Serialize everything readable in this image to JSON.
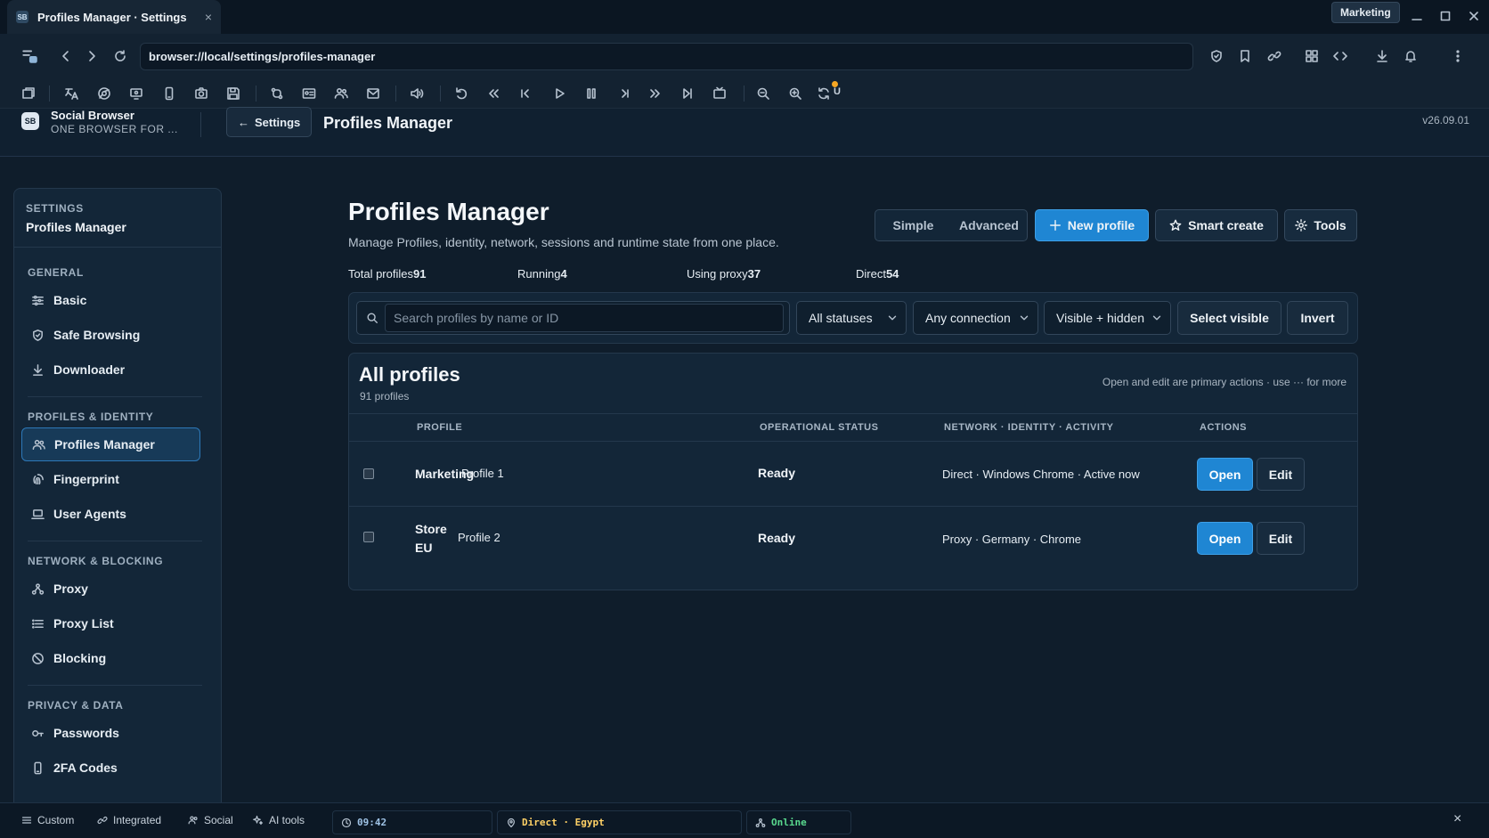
{
  "window": {
    "tab_title": "Profiles Manager · Settings",
    "tab_close": "×",
    "favicon_text": "SB",
    "active_profile": "Marketing"
  },
  "address_bar": {
    "url": "browser://local/settings/profiles-manager"
  },
  "toolbar": {
    "badge": "U"
  },
  "app_header": {
    "logo_text": "SB",
    "brand_name": "Social Browser",
    "brand_tagline": "ONE BROWSER FOR ...",
    "back_label": "Settings",
    "back_arrow": "←",
    "title": "Profiles Manager",
    "version": "v26.09.01"
  },
  "sidebar": {
    "label": "SETTINGS",
    "title": "Profiles Manager",
    "sections": [
      {
        "title": "GENERAL",
        "items": [
          {
            "label": "Basic",
            "icon": "sliders-icon"
          },
          {
            "label": "Safe Browsing",
            "icon": "shield-icon"
          },
          {
            "label": "Downloader",
            "icon": "download-icon"
          }
        ]
      },
      {
        "title": "PROFILES & IDENTITY",
        "items": [
          {
            "label": "Profiles Manager",
            "icon": "users-icon",
            "active": true
          },
          {
            "label": "Fingerprint",
            "icon": "fingerprint-icon"
          },
          {
            "label": "User Agents",
            "icon": "laptop-icon"
          }
        ]
      },
      {
        "title": "NETWORK & BLOCKING",
        "items": [
          {
            "label": "Proxy",
            "icon": "network-icon"
          },
          {
            "label": "Proxy List",
            "icon": "list-icon"
          },
          {
            "label": "Blocking",
            "icon": "ban-icon"
          }
        ]
      },
      {
        "title": "PRIVACY & DATA",
        "items": [
          {
            "label": "Passwords",
            "icon": "key-icon"
          },
          {
            "label": "2FA Codes",
            "icon": "phone-icon"
          }
        ]
      }
    ]
  },
  "main": {
    "title": "Profiles Manager",
    "subtitle": "Manage Profiles, identity, network, sessions and runtime state from one place.",
    "mode_toggle": [
      "Simple",
      "Advanced"
    ],
    "buttons": {
      "new_profile": "New profile",
      "smart_create": "Smart create",
      "tools": "Tools"
    },
    "stats": [
      {
        "label": "Total profiles",
        "value": "91"
      },
      {
        "label": "Running",
        "value": "4"
      },
      {
        "label": "Using proxy",
        "value": "37"
      },
      {
        "label": "Direct",
        "value": "54"
      }
    ],
    "filters": {
      "search_placeholder": "Search profiles by name or ID",
      "status": "All statuses",
      "connection": "Any connection",
      "visibility": "Visible + hidden",
      "select_visible": "Select visible",
      "invert": "Invert"
    },
    "table": {
      "title": "All profiles",
      "count": "91 profiles",
      "hint": "Open and edit are primary actions · use ··· for more",
      "columns": [
        "PROFILE",
        "OPERATIONAL STATUS",
        "NETWORK · IDENTITY · ACTIVITY",
        "ACTIONS"
      ],
      "rows": [
        {
          "name": "Marketing",
          "id": "Profile 1",
          "status": "Ready",
          "network": "Direct · Windows Chrome · Active now",
          "open": "Open",
          "edit": "Edit"
        },
        {
          "name_line1": "Store",
          "name_line2": "EU",
          "id": "Profile 2",
          "status": "Ready",
          "network": "Proxy · Germany · Chrome",
          "open": "Open",
          "edit": "Edit"
        }
      ]
    }
  },
  "status_bar": {
    "items": [
      "Custom",
      "Integrated",
      "Social",
      "AI tools"
    ],
    "time": "09:42",
    "connection": "Direct · Egypt",
    "online": "Online",
    "close": "×"
  },
  "colors": {
    "accent": "#1f86d3",
    "background": "#0f1d2b",
    "time": "#9fc3e6",
    "connection": "#ffd166",
    "online": "#59d98e"
  }
}
